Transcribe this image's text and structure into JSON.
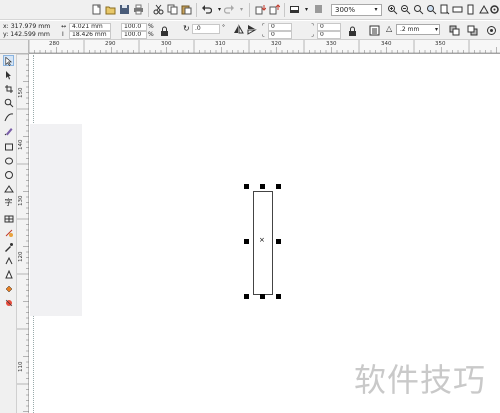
{
  "toolbar": {
    "zoom_value": "300%",
    "buttons": [
      "new-icon",
      "open-icon",
      "save-icon",
      "print-icon",
      "cut-icon",
      "copy-icon",
      "paste-icon",
      "undo-icon",
      "redo-icon",
      "import-icon",
      "export-icon",
      "launcher-icon",
      "zoom-in-icon",
      "zoom-out-icon",
      "zoom-selected-icon",
      "zoom-all-icon",
      "zoom-page-icon",
      "zoom-width-icon",
      "zoom-height-icon",
      "snap-icon",
      "options-icon"
    ]
  },
  "property_bar": {
    "x": "x: 317.979 mm",
    "y": "y: 142.599 mm",
    "width": "4.021 mm",
    "height": "18.426 mm",
    "scale_x": "100.0",
    "scale_y": "100.0",
    "percent_x": "%",
    "percent_y": "%",
    "angle": ".0",
    "degree_symbol": "°",
    "corner_values": [
      "0",
      "0",
      "0",
      "0"
    ],
    "outline_width": ".2 mm"
  },
  "rulers": {
    "horizontal_labels": [
      "280",
      "290",
      "300",
      "310",
      "320",
      "330",
      "340",
      "350"
    ],
    "vertical_labels": [
      "150",
      "140",
      "130",
      "120",
      "110"
    ]
  },
  "toolbox": {
    "tools": [
      "pick-tool-icon",
      "shape-tool-icon",
      "crop-tool-icon",
      "zoom-tool-icon",
      "freehand-tool-icon",
      "artistic-media-icon",
      "rectangle-tool-icon",
      "ellipse-tool-icon",
      "polygon-tool-icon",
      "basic-shapes-icon",
      "text-tool-icon",
      "table-tool-icon",
      "parallel-dimension-icon",
      "connector-tool-icon",
      "eyedropper-icon",
      "outline-pen-icon",
      "fill-tool-icon",
      "interactive-fill-icon"
    ],
    "text_tool_glyph": "字"
  },
  "canvas": {
    "center_marker": "×",
    "watermark": "软件技巧"
  }
}
